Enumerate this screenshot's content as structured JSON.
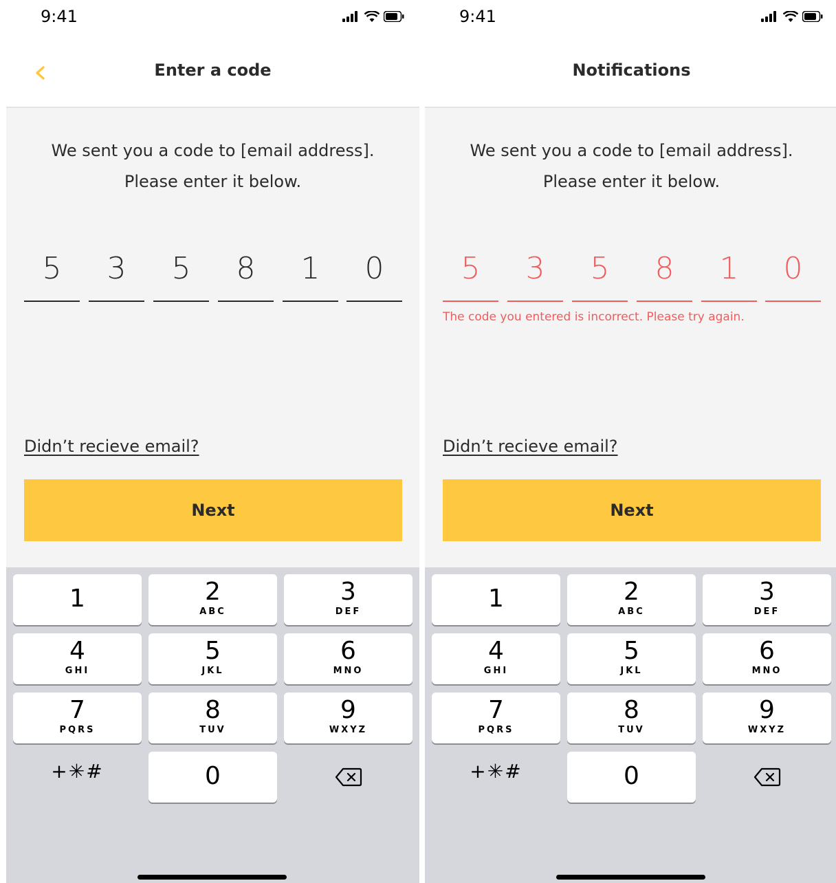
{
  "status_bar": {
    "time": "9:41"
  },
  "screens": [
    {
      "title": "Enter a code",
      "instruction_line1": "We sent you a code to [email address].",
      "instruction_line2": "Please enter it below.",
      "code_digits": [
        "5",
        "3",
        "5",
        "8",
        "1",
        "0"
      ],
      "resend_link": "Didn’t recieve email?",
      "next_label": "Next"
    },
    {
      "title": "Notifications",
      "instruction_line1": "We sent you a code to [email address].",
      "instruction_line2": "Please enter it below.",
      "code_digits": [
        "5",
        "3",
        "5",
        "8",
        "1",
        "0"
      ],
      "error_message": "The code you entered is incorrect. Please try again.",
      "resend_link": "Didn’t recieve email?",
      "next_label": "Next"
    }
  ],
  "keypad": [
    {
      "num": "1",
      "letters": ""
    },
    {
      "num": "2",
      "letters": "ABC"
    },
    {
      "num": "3",
      "letters": "DEF"
    },
    {
      "num": "4",
      "letters": "GHI"
    },
    {
      "num": "5",
      "letters": "JKL"
    },
    {
      "num": "6",
      "letters": "MNO"
    },
    {
      "num": "7",
      "letters": "PQRS"
    },
    {
      "num": "8",
      "letters": "TUV"
    },
    {
      "num": "9",
      "letters": "WXYZ"
    },
    {
      "symbols": "+✳#"
    },
    {
      "num": "0",
      "letters": ""
    },
    {
      "icon": "backspace-icon"
    }
  ],
  "colors": {
    "accent": "#fec840",
    "back_arrow": "#fec840",
    "error": "#f25b5b",
    "text": "#2b2b2b",
    "content_bg": "#f4f4f4",
    "keyboard_bg": "#d5d7dd"
  }
}
